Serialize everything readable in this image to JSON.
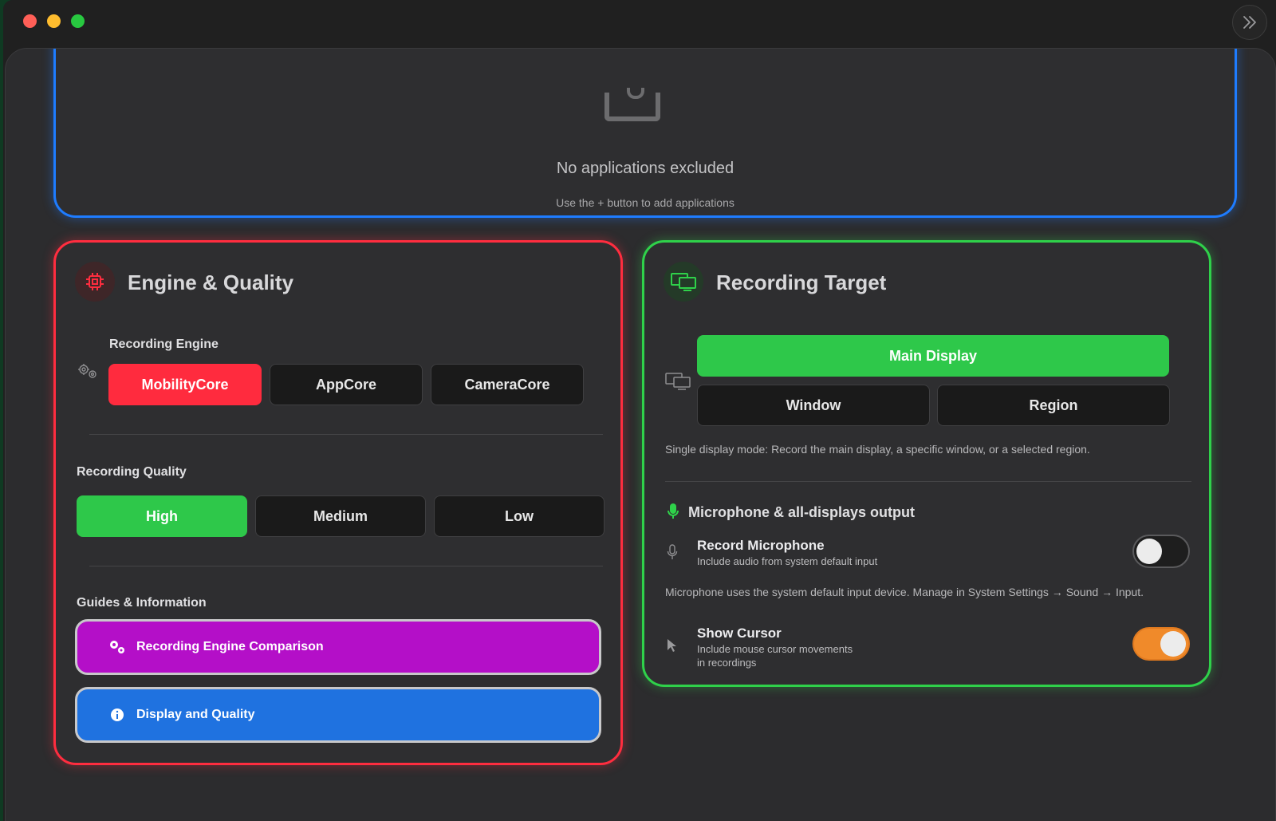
{
  "excluded": {
    "title": "No applications excluded",
    "subtitle": "Use the + button to add applications"
  },
  "engine_card": {
    "title": "Engine & Quality",
    "accent": "#ff2d3f",
    "recording_engine_label": "Recording Engine",
    "engines": [
      "MobilityCore",
      "AppCore",
      "CameraCore"
    ],
    "selected_engine": "MobilityCore",
    "quality_label": "Recording Quality",
    "qualities": [
      "High",
      "Medium",
      "Low"
    ],
    "selected_quality": "High",
    "guides_label": "Guides & Information",
    "guides": [
      "Recording Engine Comparison",
      "Display and Quality"
    ]
  },
  "target_card": {
    "title": "Recording Target",
    "accent": "#2fd14a",
    "targets": [
      "Main Display",
      "Window",
      "Region"
    ],
    "selected_target": "Main Display",
    "target_desc": "Single display mode: Record the main display, a specific window, or a selected region.",
    "mic_section_label": "Microphone & all-displays output",
    "record_mic_title": "Record Microphone",
    "record_mic_sub": "Include audio from system default input",
    "record_mic_on": false,
    "mic_note": "Microphone uses the system default input device. Manage in System Settings → Sound → Input.",
    "show_cursor_title": "Show Cursor",
    "show_cursor_sub_1": "Include mouse cursor movements",
    "show_cursor_sub_2": "in recordings",
    "show_cursor_on": true
  }
}
